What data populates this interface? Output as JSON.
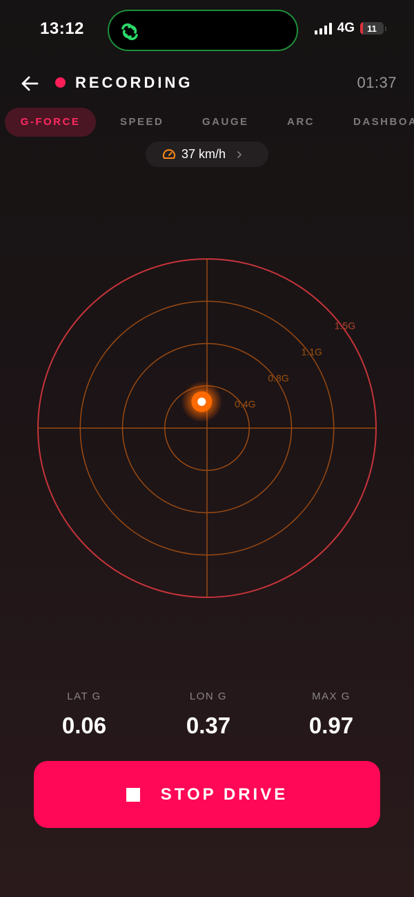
{
  "status_bar": {
    "time": "13:12",
    "network": "4G",
    "battery_level": "11",
    "icons": [
      "linked-rings-icon",
      "signal-icon",
      "battery-icon"
    ]
  },
  "header": {
    "title": "RECORDING",
    "elapsed": "01:37",
    "icons": [
      "back-arrow-icon",
      "recording-dot-icon"
    ]
  },
  "tabs": [
    {
      "label": "G-FORCE",
      "active": true
    },
    {
      "label": "SPEED",
      "active": false
    },
    {
      "label": "GAUGE",
      "active": false
    },
    {
      "label": "ARC",
      "active": false
    },
    {
      "label": "DASHBOARD",
      "active": false
    }
  ],
  "speed_pill": {
    "value": "37 km/h",
    "icons": [
      "speedometer-icon",
      "chevron-right-icon"
    ]
  },
  "gforce": {
    "ring_labels": [
      "0.4G",
      "0.8G",
      "1.1G",
      "1.5G"
    ],
    "ring_values": [
      0.4,
      0.8,
      1.2,
      1.6
    ],
    "current_point": {
      "lat": -0.05,
      "lon": 0.25
    }
  },
  "stats": [
    {
      "label": "LAT G",
      "value": "0.06"
    },
    {
      "label": "LON G",
      "value": "0.37"
    },
    {
      "label": "MAX G",
      "value": "0.97"
    }
  ],
  "stop_button": {
    "label": "STOP DRIVE",
    "icon": "stop-square-icon"
  },
  "colors": {
    "accent": "#ff0857",
    "recording": "#ff1f58",
    "ring_inner": "#9a4a12",
    "ring_outer": "#c7343a",
    "dot_glow": "#ff7a00"
  }
}
